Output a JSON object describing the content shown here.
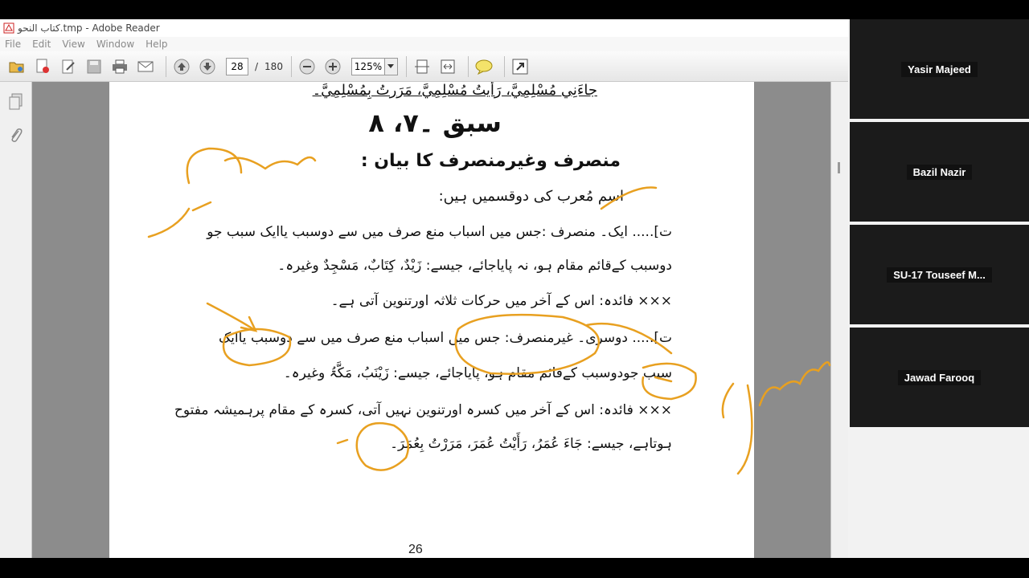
{
  "window": {
    "title": "كتاب النحو.tmp - Adobe Reader"
  },
  "menu": [
    "File",
    "Edit",
    "View",
    "Window",
    "Help"
  ],
  "toolbar": {
    "page_current": "28",
    "page_total": "180",
    "zoom": "125%"
  },
  "document": {
    "top_line": "جاءَنِي مُسْلِمِيَّ، رَأيتُ مُسْلِمِيَّ، مَرَرتُ بِمُسْلِمِيَّ۔",
    "heading": "سبق ۔۷، ۸",
    "subheading": "منصرف وغیرمنصرف کا بیان :",
    "lines": [
      "اسم مُعرب کی دوقسمیں ہیں:",
      "ت]..... ایک۔ منصرف :جس میں اسباب منع صرف میں سے دوسبب یاایک سبب جو",
      "دوسبب کےقائم مقام ہو، نہ پایاجائے، جیسے: زَیْدٌ، کِتَابٌ، مَسْجِدٌ وغیرہ۔",
      "××× فائدہ: اس کے آخر میں حرکات ثلاثہ اورتنوین آتی ہے۔",
      "ت]..... دوسری۔ غیرمنصرف: جس میں اسباب منع صرف میں سے دوسبب یاایک",
      "سبب جودوسبب کےقائم مقام ہو، پایاجائے، جیسے: زَیْنَبُ، مَکَّۃُ وغیرہ۔",
      "××× فائدہ: اس کے آخر میں کسرہ اورتنوین نہیں آتی، کسرہ کے مقام پرہمیشہ مفتوح",
      "ہوتاہے، جیسے: جَاءَ عُمَرُ، رَأَیْتُ عُمَرَ، مَرَرْتُ بِعُمَرَ۔"
    ],
    "page_number": "26"
  },
  "participants": [
    {
      "name": "Yasir Majeed"
    },
    {
      "name": "Bazil Nazir"
    },
    {
      "name": "SU-17 Touseef M..."
    },
    {
      "name": "Jawad Farooq"
    }
  ],
  "colors": {
    "ink": "#e8a020",
    "tile_bg": "#1b1b1b"
  }
}
